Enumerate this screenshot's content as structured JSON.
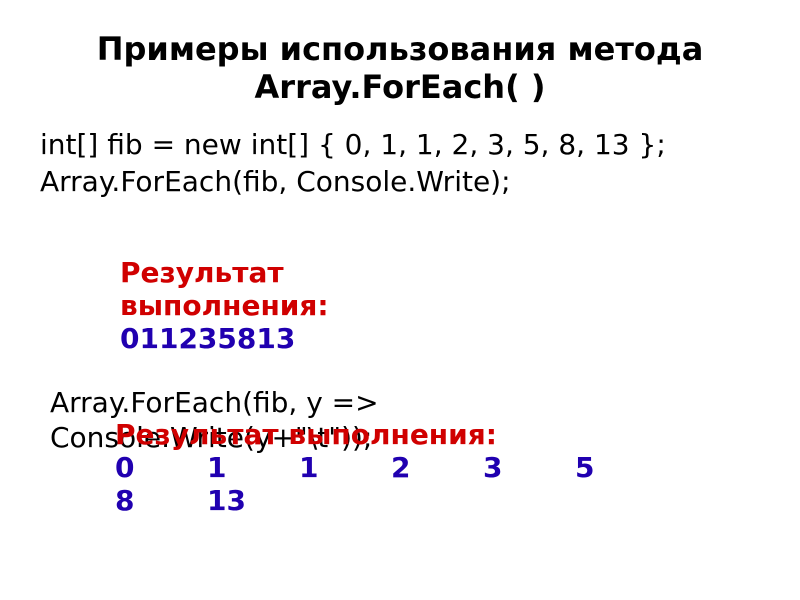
{
  "title": "Примеры использования метода Array.ForEach( )",
  "code_line1": "int[] fib = new int[] { 0, 1, 1, 2, 3, 5, 8, 13 };",
  "code_line2": "Array.ForEach(fib, Console.Write);",
  "result1_label_a": "Результат",
  "result1_label_b": "выполнения:",
  "result1_output": "011235813",
  "code_line3a": "Array.ForEach(fib, y =>",
  "code_line3b": "Console.Write(y+\"\\t\"));",
  "result2_label": "Результат выполнения:",
  "result2_values": [
    "0",
    "1",
    "1",
    "2",
    "3",
    "5",
    "8",
    "13"
  ]
}
